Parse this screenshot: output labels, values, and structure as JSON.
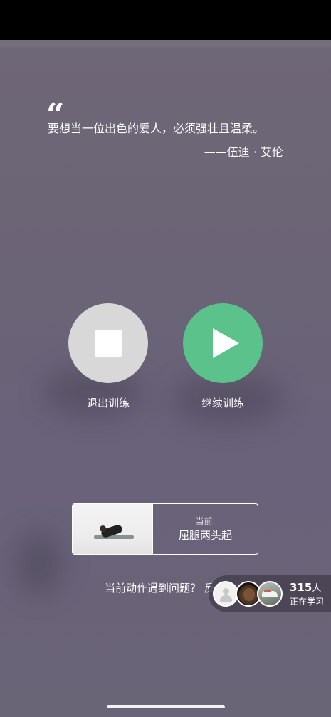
{
  "quote": {
    "mark": "“",
    "text": "要想当一位出色的爱人，必须强壮且温柔。",
    "author": "——伍迪 · 艾伦"
  },
  "actions": {
    "exit_label": "退出训练",
    "continue_label": "继续训练"
  },
  "current_exercise": {
    "caption": "当前:",
    "name": "屈腿两头起"
  },
  "feedback": {
    "text": "当前动作遇到问题？ 反"
  },
  "learners": {
    "count": "315",
    "unit": "人",
    "label": "正在学习",
    "avatars": [
      "default-avatar-icon",
      "user-avatar-child",
      "user-avatar-shoe"
    ]
  },
  "colors": {
    "overlay": "#6b6476",
    "continue_green": "#5cc28b",
    "exit_gray": "#d8d8d8"
  }
}
